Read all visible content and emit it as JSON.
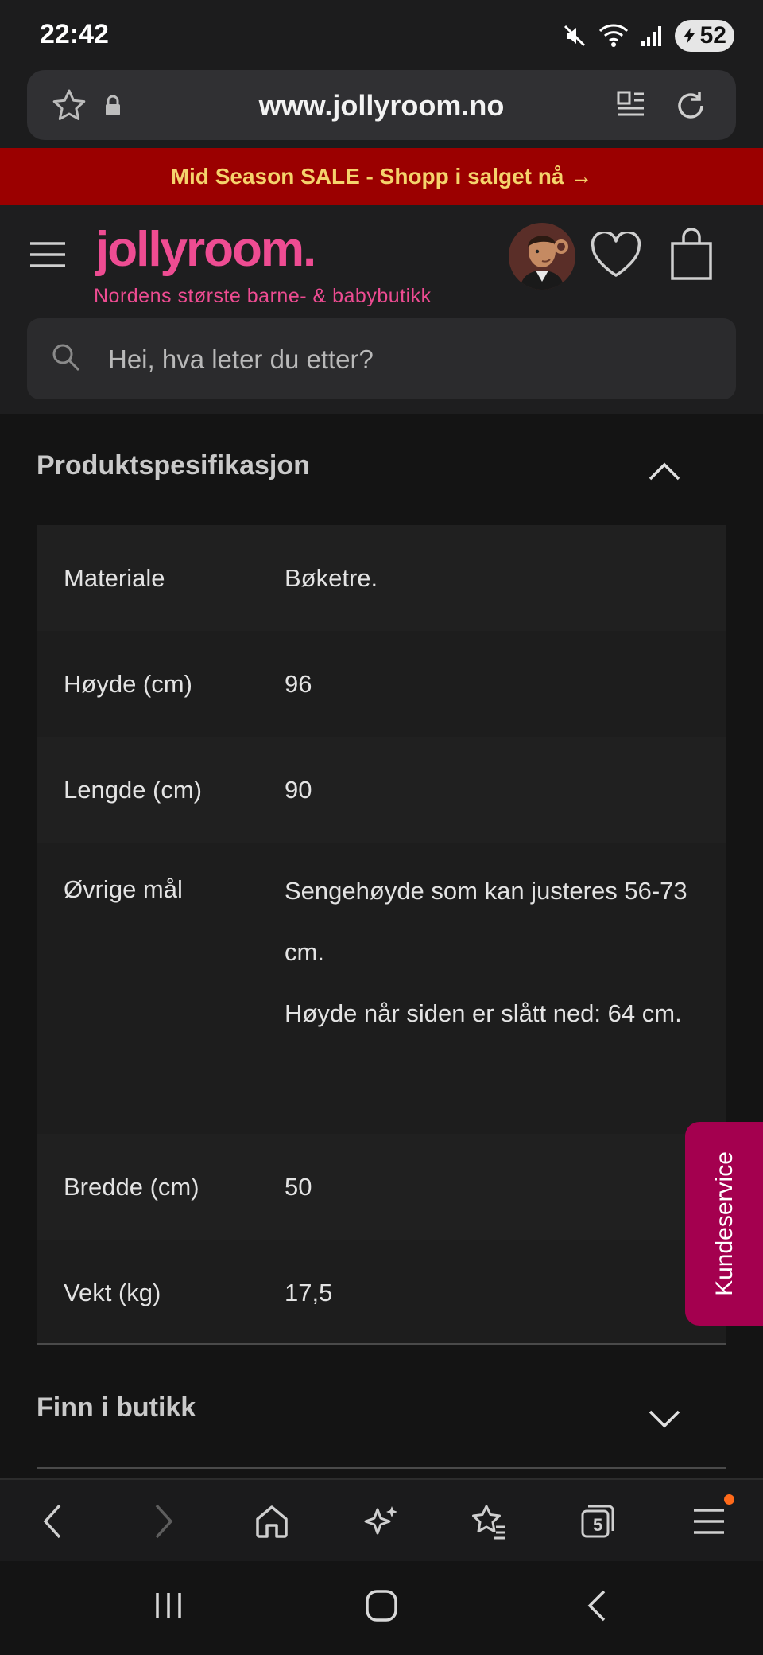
{
  "status_bar": {
    "time": "22:42",
    "battery": "52"
  },
  "browser": {
    "url": "www.jollyroom.no",
    "tabs_count": "5"
  },
  "sale_banner": {
    "text": "Mid Season SALE - Shopp i salget nå →"
  },
  "header": {
    "logo": "jollyroom.",
    "tagline": "Nordens største barne- & babybutikk",
    "search_placeholder": "Hei, hva leter du etter?"
  },
  "spec_section": {
    "title": "Produktspesifikasjon",
    "rows": [
      {
        "label": "Materiale",
        "values": [
          "Bøketre."
        ]
      },
      {
        "label": "Høyde (cm)",
        "values": [
          "96"
        ]
      },
      {
        "label": "Lengde (cm)",
        "values": [
          "90"
        ]
      },
      {
        "label": "Øvrige mål",
        "values": [
          "Sengehøyde som kan justeres 56-73 cm.",
          "Høyde når siden er slått ned: 64 cm."
        ]
      },
      {
        "label": "Bredde (cm)",
        "values": [
          "50"
        ]
      },
      {
        "label": "Vekt (kg)",
        "values": [
          "17,5"
        ]
      }
    ]
  },
  "store_section": {
    "title": "Finn i butikk"
  },
  "kundeservice": {
    "label": "Kundeservice"
  },
  "colors": {
    "brand_pink": "#ee4c92",
    "sale_red": "#9b0000",
    "sale_text": "#f5d36c",
    "kundeservice": "#a4004f"
  },
  "icons": [
    "mute-icon",
    "wifi-icon",
    "signal-icon",
    "battery-icon",
    "star-icon",
    "lock-icon",
    "reader-icon",
    "reload-icon",
    "menu-icon",
    "avatar",
    "heart-icon",
    "bag-icon",
    "search-icon",
    "chevron-up-icon",
    "chevron-down-icon",
    "back-icon",
    "forward-icon",
    "home-icon",
    "ai-sparkle-icon",
    "bookmarks-icon",
    "tabs-icon",
    "browser-menu-icon"
  ]
}
